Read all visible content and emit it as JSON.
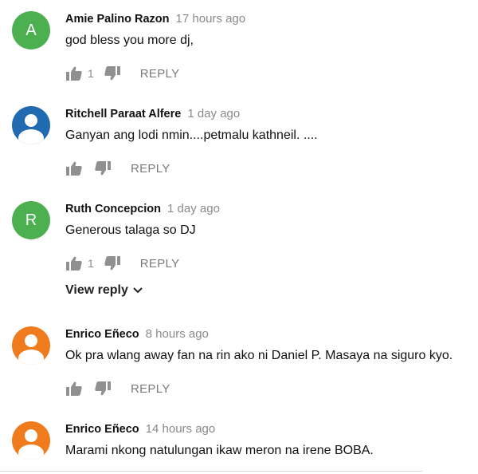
{
  "colors": {
    "avatar_green": "#4caf50",
    "avatar_blue": "#1f6ab0",
    "avatar_orange": "#f07b1d",
    "muted_text": "#8a8a8a",
    "icon_grey": "#909090"
  },
  "comments": [
    {
      "author": "Amie Palino Razon",
      "time": "17 hours ago",
      "text": "god   bless  you more  dj,",
      "avatar_letter": "A",
      "avatar_color": "#4caf50",
      "likes": "1",
      "reply_label": "REPLY"
    },
    {
      "author": "Ritchell Paraat Alfere",
      "time": "1 day ago",
      "text": "Ganyan ang lodi nmin....petmalu kathneil. ....",
      "avatar_icon": "person-icon",
      "avatar_color": "#1f6ab0",
      "likes": "",
      "reply_label": "REPLY"
    },
    {
      "author": "Ruth Concepcion",
      "time": "1 day ago",
      "text": "Generous talaga so DJ",
      "avatar_letter": "R",
      "avatar_color": "#4caf50",
      "likes": "1",
      "reply_label": "REPLY"
    },
    {
      "author": "Enrico Eñeco",
      "time": "8 hours ago",
      "text": "Ok pra wlang away fan na rin ako ni Daniel P. Masaya na siguro kyo.",
      "avatar_icon": "person-icon",
      "avatar_color": "#f07b1d",
      "likes": "",
      "reply_label": "REPLY"
    },
    {
      "author": "Enrico Eñeco",
      "time": "14 hours ago",
      "text": "Marami nkong natulungan ikaw meron na irene BOBA.",
      "avatar_icon": "person-icon",
      "avatar_color": "#f07b1d"
    }
  ],
  "view_reply_label": "View reply"
}
